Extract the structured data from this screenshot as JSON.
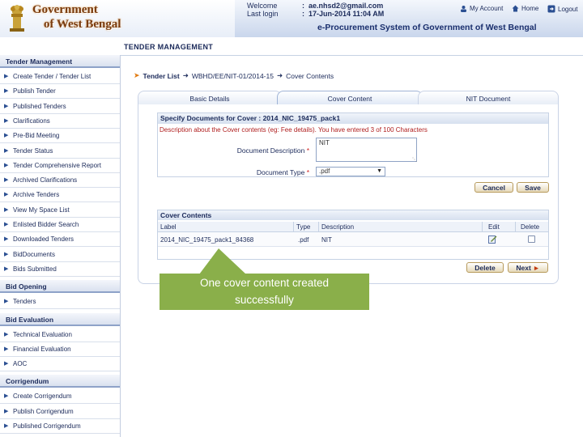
{
  "header": {
    "logo_line1": "Government",
    "logo_line2": "of West Bengal",
    "welcome_label": "Welcome",
    "welcome_value": "ae.nhsd2@gmail.com",
    "last_login_label": "Last login",
    "last_login_value": "17-Jun-2014 11:04 AM",
    "my_account": "My Account",
    "home": "Home",
    "logout": "Logout",
    "portal_title": "e-Procurement System of Government of West Bengal"
  },
  "subbar": {
    "title": "TENDER MANAGEMENT"
  },
  "sidebar": {
    "sections": [
      {
        "title": "Tender Management",
        "items": [
          "Create Tender / Tender List",
          "Publish Tender",
          "Published Tenders",
          "Clarifications",
          "Pre-Bid Meeting",
          "Tender Status",
          "Tender Comprehensive Report",
          "Archived Clarifications",
          "Archive Tenders",
          "View My Space List",
          "Enlisted Bidder Search",
          "Downloaded Tenders",
          "BidDocuments",
          "Bids Submitted"
        ]
      },
      {
        "title": "Bid Opening",
        "items": [
          "Tenders"
        ]
      },
      {
        "title": "Bid Evaluation",
        "items": [
          "Technical Evaluation",
          "Financial Evaluation",
          "AOC"
        ]
      },
      {
        "title": "Corrigendum",
        "items": [
          "Create Corrigendum",
          "Publish Corrigendum",
          "Published Corrigendum"
        ]
      }
    ]
  },
  "breadcrumb": {
    "item1": "Tender List",
    "item2": "WBHD/EE/NIT-01/2014-15",
    "item3": "Cover Contents"
  },
  "tabs": [
    {
      "label": "Basic Details"
    },
    {
      "label": "Cover Content"
    },
    {
      "label": "NIT Document"
    }
  ],
  "form": {
    "heading": "Specify Documents for Cover : 2014_NIC_19475_pack1",
    "desc_note": "Description about the Cover contents (eg: Fee details). You have entered 3 of 100 Characters",
    "doc_desc_label": "Document Description",
    "doc_desc_value": "NIT",
    "doc_type_label": "Document Type",
    "doc_type_value": ".pdf",
    "required_mark": "*",
    "cancel": "Cancel",
    "save": "Save"
  },
  "cover_table": {
    "heading": "Cover Contents",
    "columns": [
      "Label",
      "Type",
      "Description",
      "Edit",
      "Delete"
    ],
    "rows": [
      {
        "label": "2014_NIC_19475_pack1_84368",
        "type": ".pdf",
        "description": "NIT"
      }
    ]
  },
  "actions": {
    "delete": "Delete",
    "next": "Next"
  },
  "callout": {
    "line1": "One cover content created",
    "line2": "successfully"
  },
  "colors": {
    "callout": "#8aaf4a",
    "accent_red": "#b02020",
    "navy": "#1b2a5a"
  }
}
